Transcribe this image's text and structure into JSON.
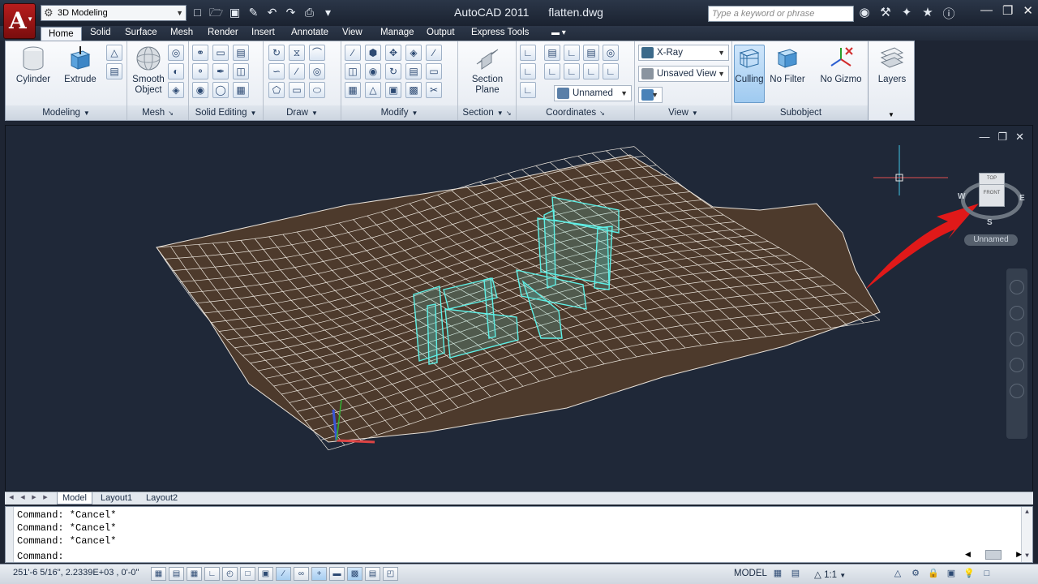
{
  "title": {
    "app_name": "AutoCAD 2011",
    "file_name": "flatten.dwg",
    "workspace": "3D Modeling",
    "search_placeholder": "Type a keyword or phrase"
  },
  "tabs": [
    "Home",
    "Solid",
    "Surface",
    "Mesh",
    "Render",
    "Insert",
    "Annotate",
    "View",
    "Manage",
    "Output",
    "Express Tools"
  ],
  "active_tab": "Home",
  "ribbon": {
    "cylinder_label": "Cylinder",
    "extrude_label": "Extrude",
    "smooth_object_label_1": "Smooth",
    "smooth_object_label_2": "Object",
    "section_plane_label_1": "Section",
    "section_plane_label_2": "Plane",
    "xray_label": "X-Ray",
    "unsaved_view_label": "Unsaved View",
    "unnamed_label": "Unnamed",
    "culling_label": "Culling",
    "no_filter_label": "No Filter",
    "no_gizmo_label": "No Gizmo",
    "layers_label": "Layers",
    "panels": {
      "modeling": "Modeling",
      "mesh": "Mesh",
      "solid_editing": "Solid Editing",
      "draw": "Draw",
      "modify": "Modify",
      "section": "Section",
      "coordinates": "Coordinates",
      "view": "View",
      "subobject": "Subobject"
    }
  },
  "viewport": {
    "viewcube_top": "TOP",
    "viewcube_front": "FRONT",
    "viewcube_w": "W",
    "viewcube_e": "E",
    "viewcube_s": "S",
    "ucs_name": "Unnamed",
    "surface_color": "#4d3a2c",
    "solid_color": "#5ff0e6",
    "arrow_color": "#e01919"
  },
  "layout_tabs": [
    "Model",
    "Layout1",
    "Layout2"
  ],
  "command": {
    "history": [
      "Command: *Cancel*",
      "Command: *Cancel*",
      "Command: *Cancel*"
    ],
    "prompt": "Command:"
  },
  "status": {
    "coordinates": "251'-6 5/16\", 2.2339E+03 , 0'-0\"",
    "model_label": "MODEL",
    "scale": "1:1"
  }
}
